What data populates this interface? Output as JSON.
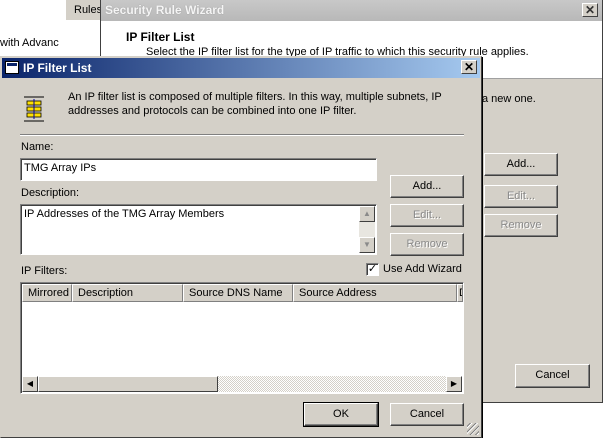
{
  "background": {
    "left_text": "with Advanc",
    "rules_tab": "Rules",
    "wizard": {
      "title": "Security Rule Wizard",
      "close_glyph": "✕",
      "header_title": "IP Filter List",
      "header_subtitle": "Select the IP filter list for the type of IP traffic to which this security rule applies.",
      "partial_text": "a new one.",
      "buttons": {
        "add": "Add...",
        "edit": "Edit...",
        "remove": "Remove",
        "cancel": "Cancel"
      }
    }
  },
  "dialog": {
    "title": "IP Filter List",
    "close_glyph": "✕",
    "icon": "ip-filter-list-icon",
    "intro": "An IP filter list is composed of multiple filters. In this way, multiple subnets, IP addresses and protocols can be combined into one IP filter.",
    "name_label": "Name:",
    "name_value": "TMG Array IPs",
    "description_label": "Description:",
    "description_value": "IP Addresses of the TMG Array Members",
    "buttons": {
      "add": "Add...",
      "edit": "Edit...",
      "remove": "Remove",
      "ok": "OK",
      "cancel": "Cancel"
    },
    "use_add_wizard_label": "Use Add Wizard",
    "use_add_wizard_checked": "✓",
    "ip_filters_label": "IP Filters:",
    "columns": [
      "Mirrored",
      "Description",
      "Source DNS Name",
      "Source Address",
      "D"
    ]
  }
}
